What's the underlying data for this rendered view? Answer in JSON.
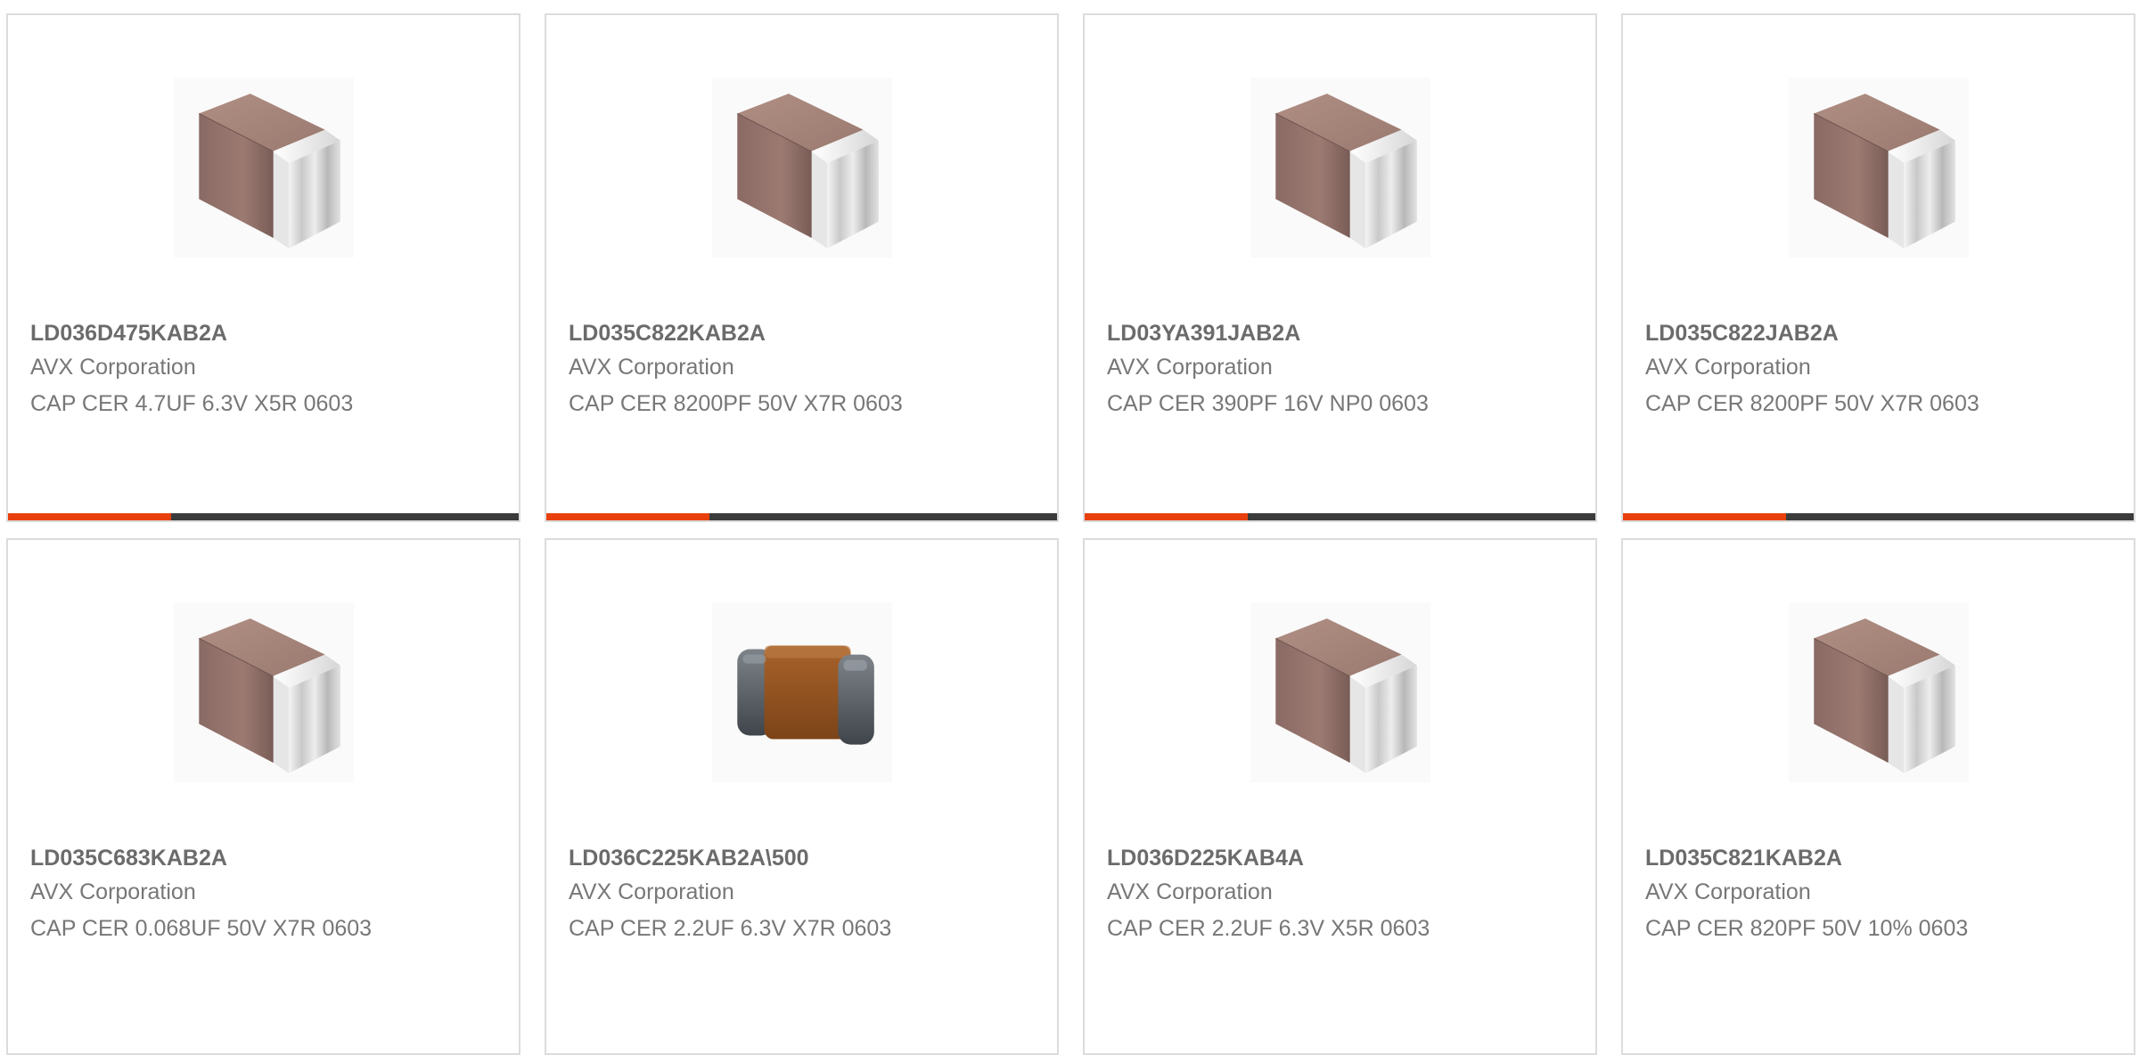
{
  "colors": {
    "accent": "#e8400c",
    "progress_track": "#3b3b3b",
    "card_border": "#dcdcdc",
    "text": "#777777"
  },
  "products": [
    {
      "part_number": "LD036D475KAB2A",
      "manufacturer": "AVX Corporation",
      "description": "CAP CER 4.7UF 6.3V X5R 0603",
      "image_icon": "ceramic-capacitor-brown",
      "progress": 0.32
    },
    {
      "part_number": "LD035C822KAB2A",
      "manufacturer": "AVX Corporation",
      "description": "CAP CER 8200PF 50V X7R 0603",
      "image_icon": "ceramic-capacitor-brown",
      "progress": 0.32
    },
    {
      "part_number": "LD03YA391JAB2A",
      "manufacturer": "AVX Corporation",
      "description": "CAP CER 390PF 16V NP0 0603",
      "image_icon": "ceramic-capacitor-brown",
      "progress": 0.32
    },
    {
      "part_number": "LD035C822JAB2A",
      "manufacturer": "AVX Corporation",
      "description": "CAP CER 8200PF 50V X7R 0603",
      "image_icon": "ceramic-capacitor-brown",
      "progress": 0.32
    },
    {
      "part_number": "LD035C683KAB2A",
      "manufacturer": "AVX Corporation",
      "description": "CAP CER 0.068UF 50V X7R 0603",
      "image_icon": "ceramic-capacitor-brown"
    },
    {
      "part_number": "LD036C225KAB2A\\500",
      "manufacturer": "AVX Corporation",
      "description": "CAP CER 2.2UF 6.3V X7R 0603",
      "image_icon": "ceramic-capacitor-orange"
    },
    {
      "part_number": "LD036D225KAB4A",
      "manufacturer": "AVX Corporation",
      "description": "CAP CER 2.2UF 6.3V X5R 0603",
      "image_icon": "ceramic-capacitor-brown"
    },
    {
      "part_number": "LD035C821KAB2A",
      "manufacturer": "AVX Corporation",
      "description": "CAP CER 820PF 50V 10% 0603",
      "image_icon": "ceramic-capacitor-brown"
    }
  ]
}
